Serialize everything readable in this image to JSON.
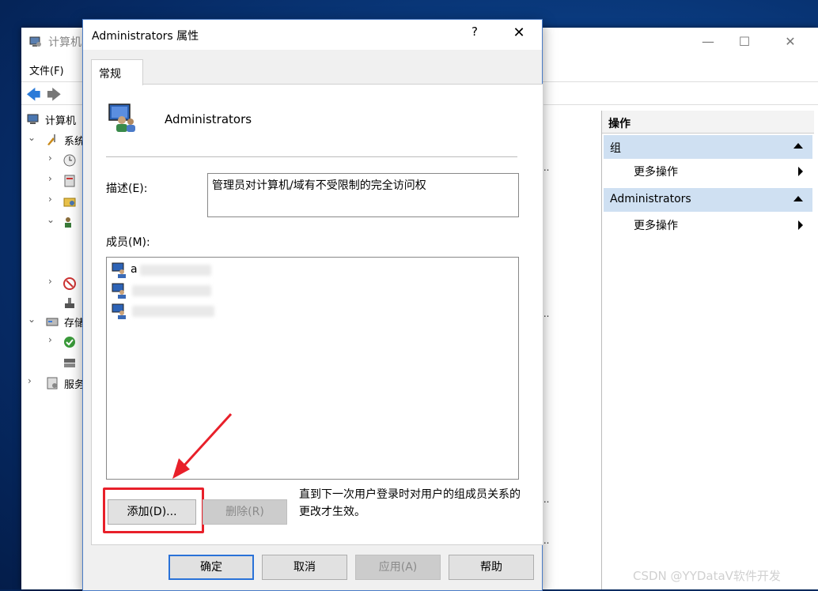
{
  "background_window": {
    "title": "计算机",
    "menu_file": "文件(F)",
    "tree": [
      {
        "label": "计算机"
      },
      {
        "label": "系统"
      },
      {
        "label": ""
      },
      {
        "label": ""
      },
      {
        "label": ""
      },
      {
        "label": ""
      },
      {
        "label": ""
      },
      {
        "label": ""
      },
      {
        "label": "存储"
      },
      {
        "label": ""
      },
      {
        "label": ""
      },
      {
        "label": "服务"
      }
    ],
    "actions": {
      "title": "操作",
      "sections": [
        {
          "header": "组",
          "item": "更多操作"
        },
        {
          "header": "Administrators",
          "item": "更多操作"
        }
      ]
    },
    "center_ellipsis": "..."
  },
  "dialog": {
    "title": "Administrators 属性",
    "help": "?",
    "close": "✕",
    "tab_general": "常规",
    "group_name": "Administrators",
    "description_label": "描述(E):",
    "description_value": "管理员对计算机/域有不受限制的完全访问权",
    "members_label": "成员(M):",
    "members": [
      "a",
      "",
      ""
    ],
    "add_button": "添加(D)...",
    "remove_button": "删除(R)",
    "note": "直到下一次用户登录时对用户的组成员关系的更改才生效。",
    "ok_button": "确定",
    "cancel_button": "取消",
    "apply_button": "应用(A)",
    "help_button": "帮助"
  },
  "annotation": {
    "highlight_color": "#e8202a"
  },
  "watermark": "CSDN @YYDataV软件开发"
}
